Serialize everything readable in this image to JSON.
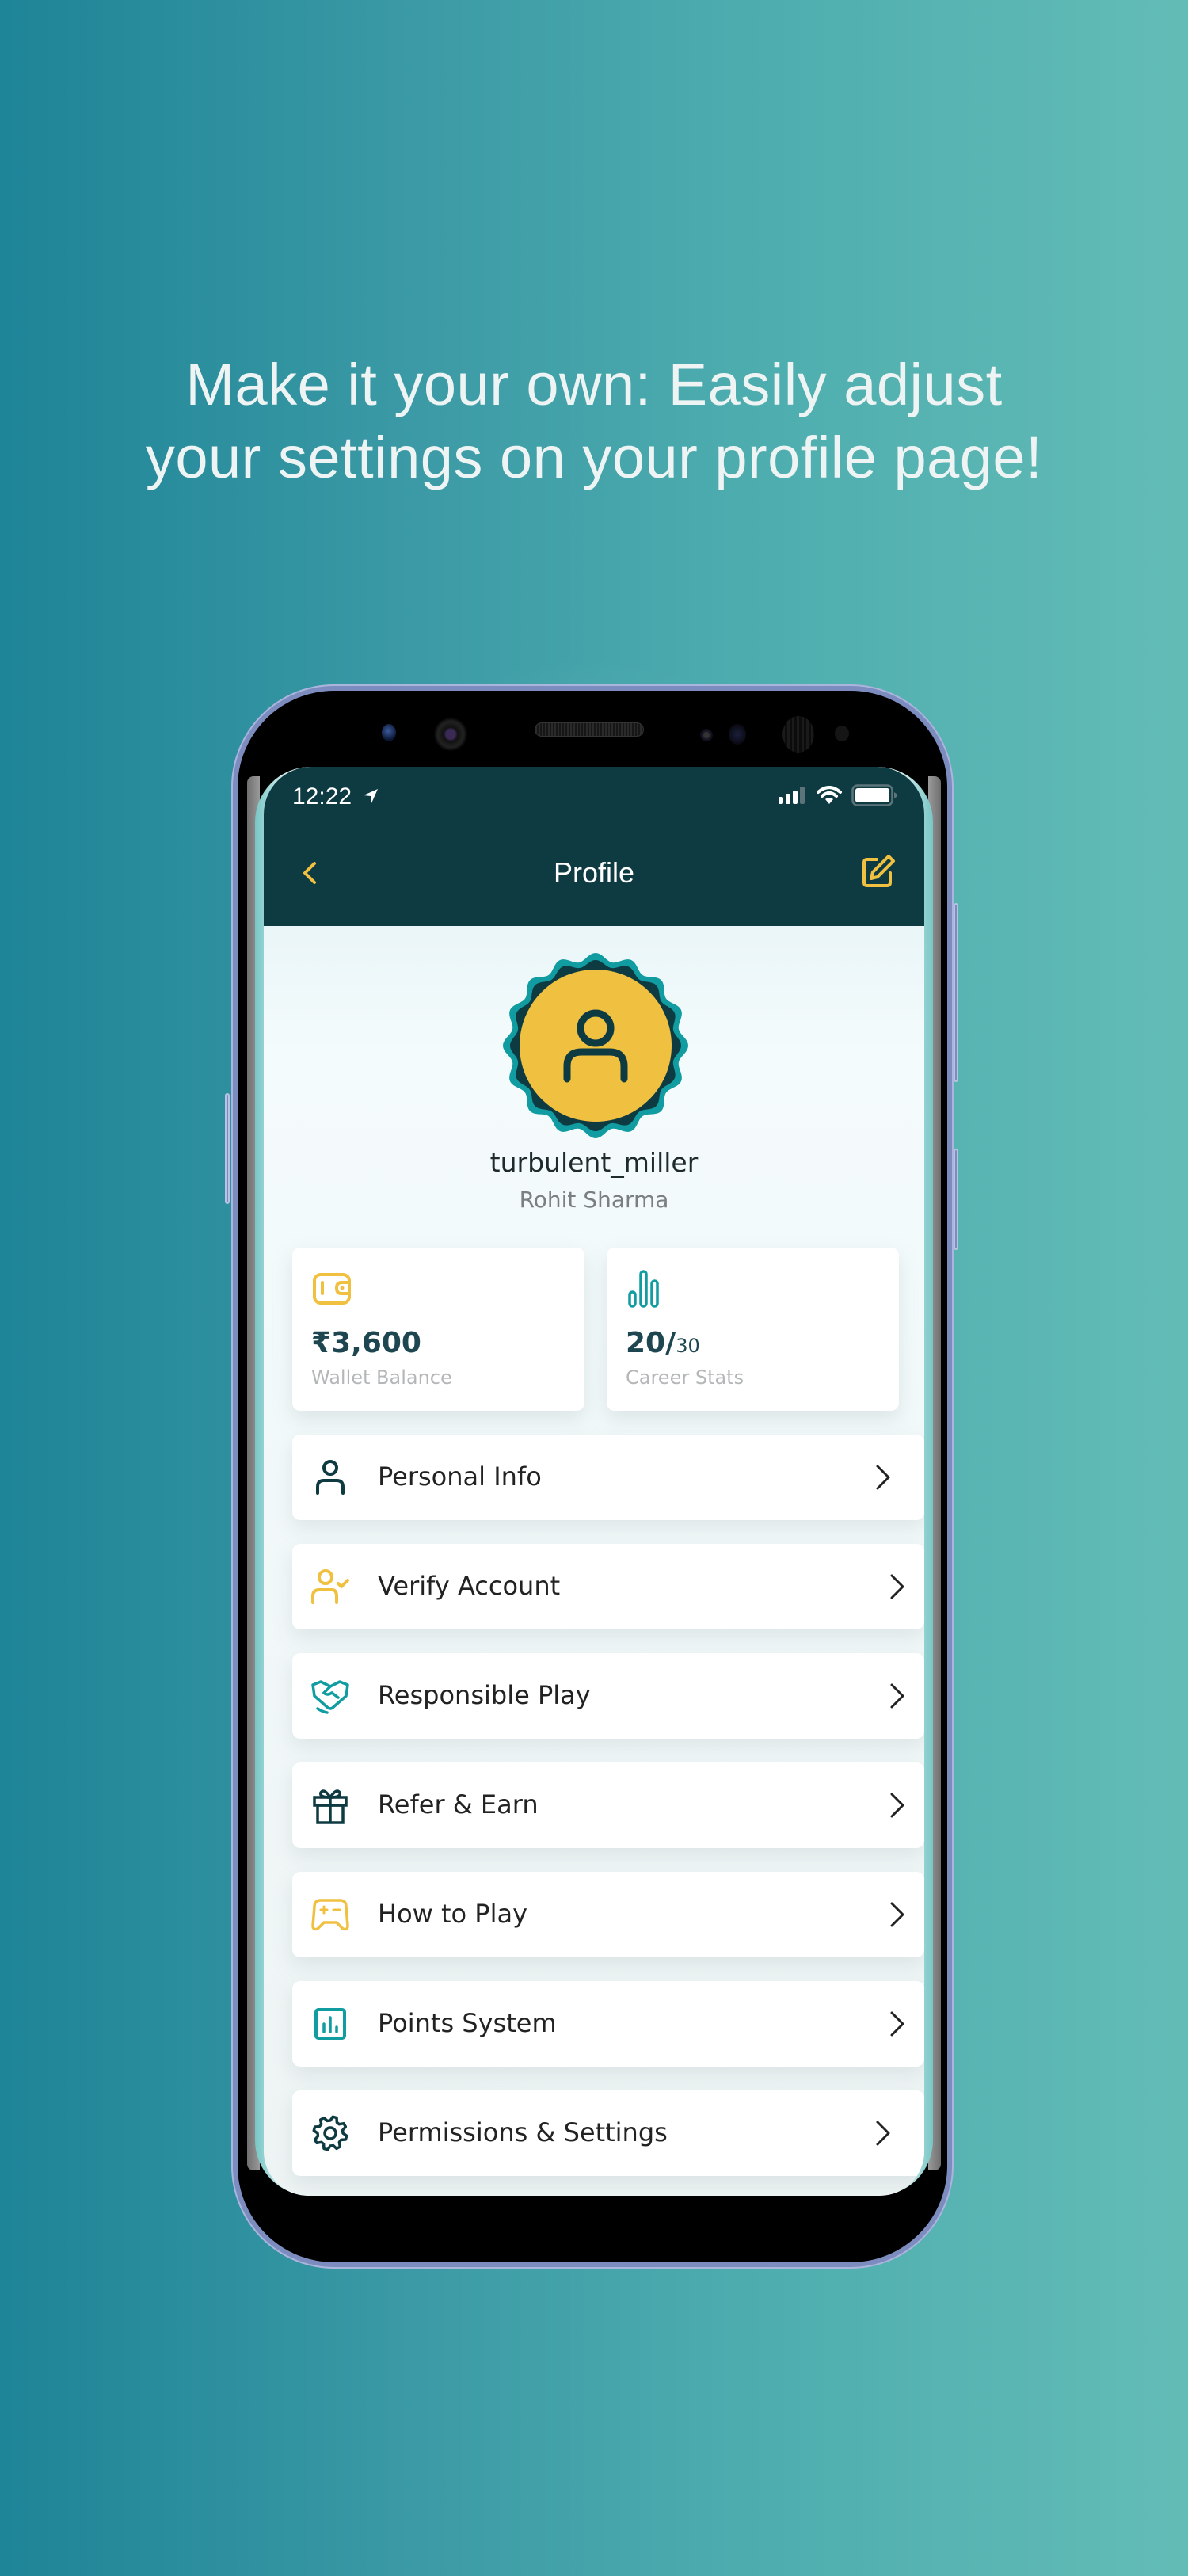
{
  "headline": {
    "line1": "Make it your own: Easily adjust",
    "line2": "your settings on your profile page!"
  },
  "status_bar": {
    "time": "12:22",
    "location_icon": "location-arrow-icon",
    "signal_icon": "cellular-signal-icon",
    "wifi_icon": "wifi-icon",
    "battery_icon": "battery-icon"
  },
  "nav": {
    "title": "Profile",
    "back_icon": "chevron-left-icon",
    "edit_icon": "edit-icon"
  },
  "profile": {
    "username": "turbulent_miller",
    "full_name": "Rohit Sharma",
    "avatar_icon": "user-icon"
  },
  "stats": [
    {
      "icon": "wallet-icon",
      "value": "₹3,600",
      "value_sub": "",
      "label": "Wallet Balance"
    },
    {
      "icon": "bar-chart-icon",
      "value": "20/",
      "value_sub": "30",
      "label": "Career Stats"
    }
  ],
  "menu": [
    {
      "label": "Personal Info",
      "icon": "user-icon"
    },
    {
      "label": "Verify Account",
      "icon": "user-check-icon"
    },
    {
      "label": "Responsible Play",
      "icon": "handshake-icon"
    },
    {
      "label": "Refer & Earn",
      "icon": "gift-icon"
    },
    {
      "label": "How to Play",
      "icon": "gamepad-icon"
    },
    {
      "label": "Points System",
      "icon": "chart-box-icon"
    },
    {
      "label": "Permissions & Settings",
      "icon": "gear-icon"
    }
  ],
  "colors": {
    "brand_dark": "#0e3a42",
    "accent_yellow": "#f0c040",
    "accent_teal": "#109ca0",
    "bg_gradient_start": "#1e8497",
    "bg_gradient_end": "#63bcb6"
  }
}
